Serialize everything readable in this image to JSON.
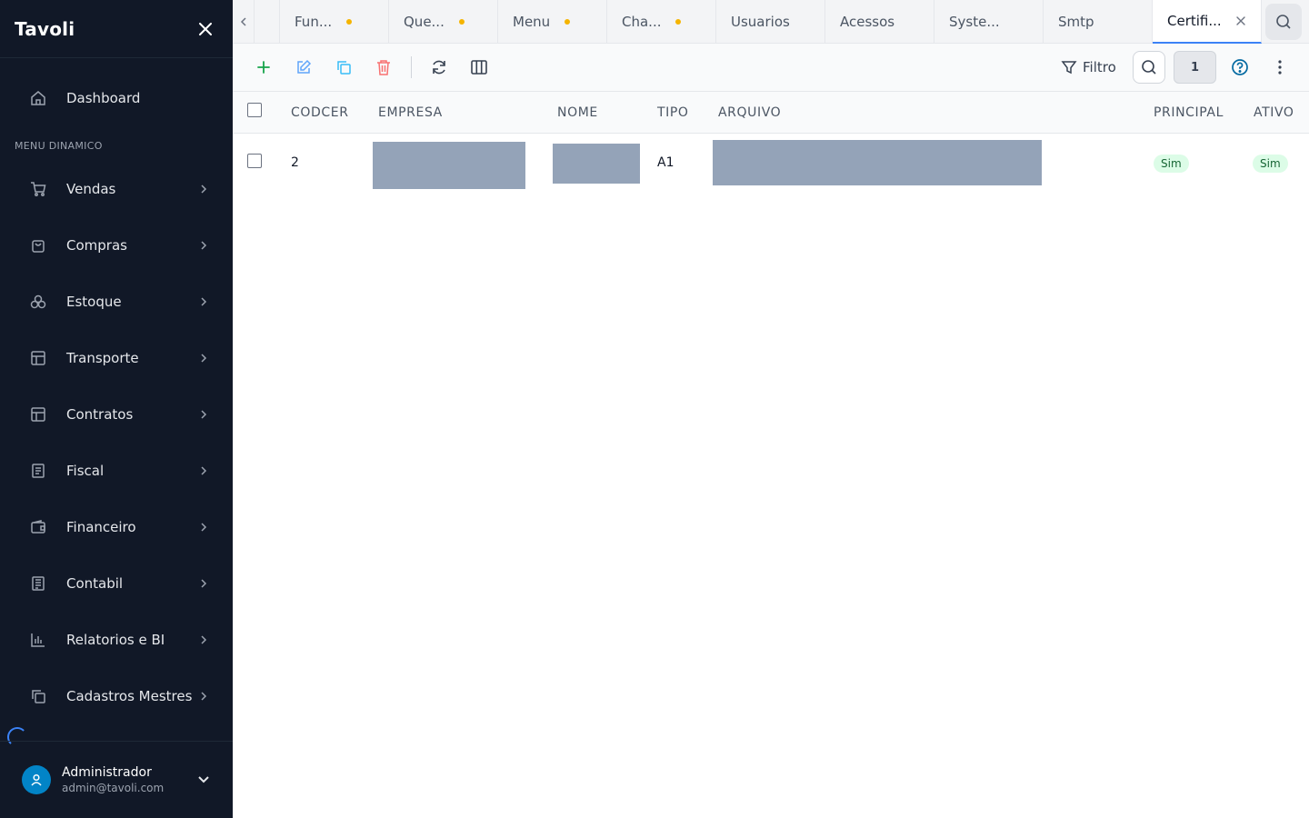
{
  "app": {
    "brand": "Tavoli"
  },
  "sidebar": {
    "dashboard": "Dashboard",
    "section_label": "MENU DINAMICO",
    "items": [
      {
        "label": "Vendas",
        "icon": "cart-icon"
      },
      {
        "label": "Compras",
        "icon": "bag-icon"
      },
      {
        "label": "Estoque",
        "icon": "boxes-icon"
      },
      {
        "label": "Transporte",
        "icon": "layout-icon"
      },
      {
        "label": "Contratos",
        "icon": "layout-icon"
      },
      {
        "label": "Fiscal",
        "icon": "document-icon"
      },
      {
        "label": "Financeiro",
        "icon": "wallet-icon"
      },
      {
        "label": "Contabil",
        "icon": "ledger-icon"
      },
      {
        "label": "Relatorios e BI",
        "icon": "bar-chart-icon"
      },
      {
        "label": "Cadastros Mestres",
        "icon": "copy-icon"
      }
    ],
    "user": {
      "name": "Administrador",
      "email": "admin@tavoli.com"
    }
  },
  "tabs": [
    {
      "label": "Fun...",
      "dirty": true
    },
    {
      "label": "Que...",
      "dirty": true
    },
    {
      "label": "Menu",
      "dirty": true
    },
    {
      "label": "Cha...",
      "dirty": true
    },
    {
      "label": "Usuarios",
      "dirty": false
    },
    {
      "label": "Acessos",
      "dirty": false
    },
    {
      "label": "Syste...",
      "dirty": false
    },
    {
      "label": "Smtp",
      "dirty": false
    },
    {
      "label": "Certifi...",
      "dirty": false,
      "active": true
    }
  ],
  "toolbar": {
    "filter_label": "Filtro",
    "count": "1"
  },
  "table": {
    "columns": [
      "CODCER",
      "EMPRESA",
      "NOME",
      "TIPO",
      "ARQUIVO",
      "PRINCIPAL",
      "ATIVO"
    ],
    "rows": [
      {
        "codcer": "2",
        "tipo": "A1",
        "principal": "Sim",
        "ativo": "Sim"
      }
    ]
  },
  "colors": {
    "sidebar_bg": "#111827",
    "accent": "#3b82f6",
    "dirty_dot": "#f5b400",
    "add": "#16a34a",
    "edit": "#60a5fa",
    "copy": "#38bdf8",
    "delete": "#f87171",
    "help": "#0369a1",
    "badge_bg": "#dcfce7",
    "badge_text": "#166534"
  }
}
